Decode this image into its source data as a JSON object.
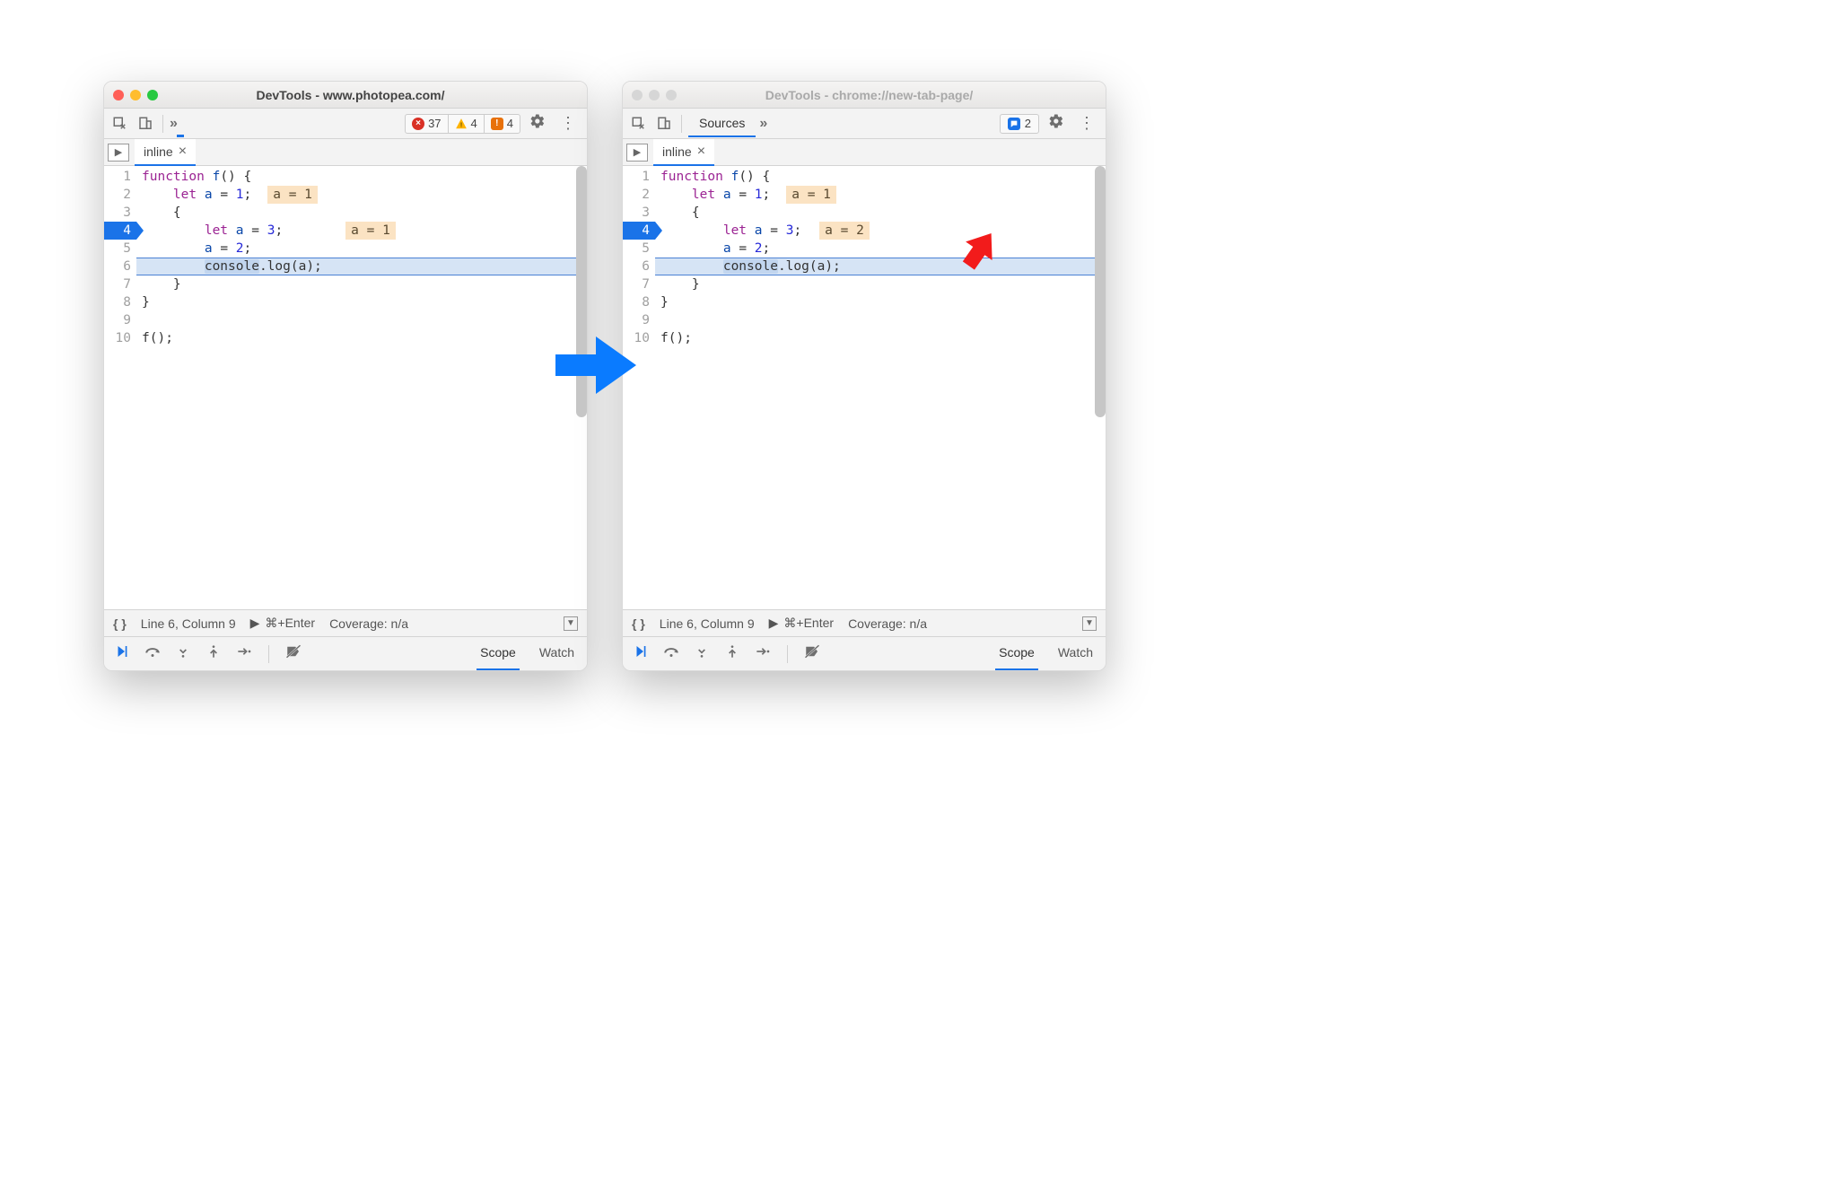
{
  "left": {
    "title": "DevTools - www.photopea.com/",
    "dots": [
      "#ff5f57",
      "#ffbd2e",
      "#28c941"
    ],
    "badges": [
      {
        "icon_bg": "#d93025",
        "glyph": "×",
        "count": "37",
        "style": "circle"
      },
      {
        "icon_bg": "#ffb300",
        "glyph": "!",
        "fg": "#5a4a00",
        "count": "4",
        "style": "triangle"
      },
      {
        "icon_bg": "#e07a00",
        "glyph": "!",
        "count": "4",
        "style": "square"
      }
    ],
    "tab_name": "inline",
    "gutter": [
      "1",
      "2",
      "3",
      "4",
      "5",
      "6",
      "7",
      "8",
      "9",
      "10"
    ],
    "breakpoint_line": "4",
    "highlight_line_index": 5,
    "code": {
      "l1": {
        "a": "function ",
        "b": "f",
        "c": "() {"
      },
      "l2": {
        "a": "    ",
        "b": "let ",
        "c": "a ",
        "d": "= ",
        "e": "1",
        "f": ";",
        "chip": "a = 1"
      },
      "l3": "    {",
      "l4": {
        "a": "        ",
        "b": "let ",
        "c": "a ",
        "d": "= ",
        "e": "3",
        "f": ";",
        "chip": "a = 1"
      },
      "l5": {
        "a": "        ",
        "b": "a ",
        "c": "= ",
        "d": "2",
        "e": ";"
      },
      "l6": {
        "a": "        ",
        "hl": "console",
        "b": ".log(a);"
      },
      "l7": "    }",
      "l8": "}",
      "l9": "",
      "l10": "f();"
    },
    "status": {
      "pretty": "{ }",
      "pos": "Line 6, Column 9",
      "run": "⌘+Enter",
      "cov": "Coverage: n/a"
    }
  },
  "right": {
    "title": "DevTools - chrome://new-tab-page/",
    "dots": [
      "#d6d6d6",
      "#d6d6d6",
      "#d6d6d6"
    ],
    "sources_label": "Sources",
    "issues": {
      "count": "2"
    },
    "tab_name": "inline",
    "gutter": [
      "1",
      "2",
      "3",
      "4",
      "5",
      "6",
      "7",
      "8",
      "9",
      "10"
    ],
    "breakpoint_line": "4",
    "highlight_line_index": 5,
    "code": {
      "l1": {
        "a": "function ",
        "b": "f",
        "c": "() {"
      },
      "l2": {
        "a": "    ",
        "b": "let ",
        "c": "a ",
        "d": "= ",
        "e": "1",
        "f": ";",
        "chip": "a = 1"
      },
      "l3": "    {",
      "l4": {
        "a": "        ",
        "b": "let ",
        "c": "a ",
        "d": "= ",
        "e": "3",
        "f": ";",
        "chip": "a = 2"
      },
      "l5": {
        "a": "        ",
        "b": "a ",
        "c": "= ",
        "d": "2",
        "e": ";"
      },
      "l6": {
        "a": "        ",
        "hl": "console",
        "b": ".log(a);"
      },
      "l7": "    }",
      "l8": "}",
      "l9": "",
      "l10": "f();"
    },
    "status": {
      "pretty": "{ }",
      "pos": "Line 6, Column 9",
      "run": "⌘+Enter",
      "cov": "Coverage: n/a"
    }
  },
  "debugger_tabs": {
    "scope": "Scope",
    "watch": "Watch"
  },
  "colors": {
    "accent": "#1a73e8",
    "arrow_red": "#f21b1b"
  }
}
